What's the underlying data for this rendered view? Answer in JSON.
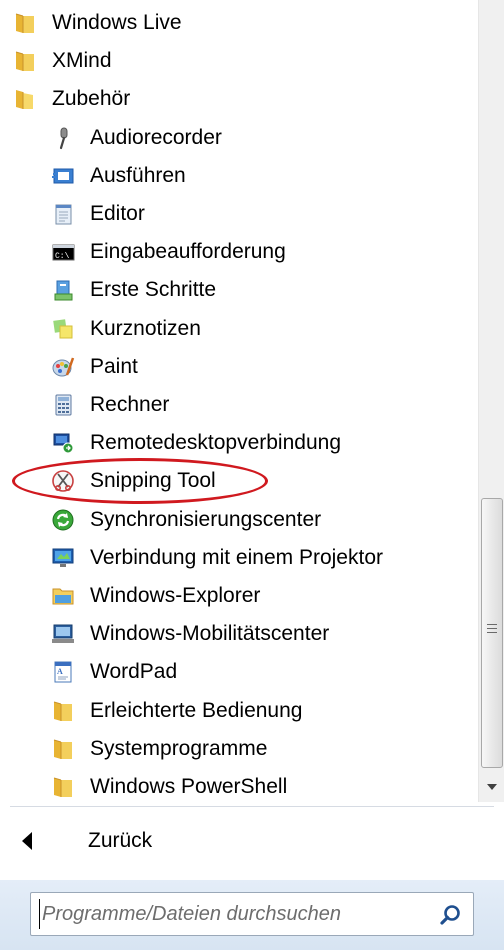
{
  "programs": {
    "items": [
      {
        "label": "Windows Live",
        "icon": "folder-icon",
        "level": 0
      },
      {
        "label": "XMind",
        "icon": "folder-icon",
        "level": 0
      },
      {
        "label": "Zubehör",
        "icon": "folder-open-icon",
        "level": 0
      },
      {
        "label": "Audiorecorder",
        "icon": "microphone-icon",
        "level": 1
      },
      {
        "label": "Ausführen",
        "icon": "run-icon",
        "level": 1
      },
      {
        "label": "Editor",
        "icon": "notepad-icon",
        "level": 1
      },
      {
        "label": "Eingabeaufforderung",
        "icon": "command-prompt-icon",
        "level": 1
      },
      {
        "label": "Erste Schritte",
        "icon": "getting-started-icon",
        "level": 1
      },
      {
        "label": "Kurznotizen",
        "icon": "sticky-notes-icon",
        "level": 1
      },
      {
        "label": "Paint",
        "icon": "paint-palette-icon",
        "level": 1
      },
      {
        "label": "Rechner",
        "icon": "calculator-icon",
        "level": 1
      },
      {
        "label": "Remotedesktopverbindung",
        "icon": "remote-desktop-icon",
        "level": 1
      },
      {
        "label": "Snipping Tool",
        "icon": "scissors-icon",
        "level": 1
      },
      {
        "label": "Synchronisierungscenter",
        "icon": "sync-icon",
        "level": 1
      },
      {
        "label": "Verbindung mit einem Projektor",
        "icon": "projector-monitor-icon",
        "level": 1
      },
      {
        "label": "Windows-Explorer",
        "icon": "explorer-folder-icon",
        "level": 1
      },
      {
        "label": "Windows-Mobilitätscenter",
        "icon": "mobility-center-icon",
        "level": 1
      },
      {
        "label": "WordPad",
        "icon": "wordpad-icon",
        "level": 1
      },
      {
        "label": "Erleichterte Bedienung",
        "icon": "folder-icon",
        "level": 1
      },
      {
        "label": "Systemprogramme",
        "icon": "folder-icon",
        "level": 1
      },
      {
        "label": "Windows PowerShell",
        "icon": "folder-icon",
        "level": 1
      }
    ],
    "highlighted": "Snipping Tool"
  },
  "back": {
    "label": "Zurück",
    "icon": "back-arrow-icon"
  },
  "search": {
    "placeholder": "Programme/Dateien durchsuchen",
    "icon": "search-icon"
  },
  "colors": {
    "highlight": "#d0191f",
    "search_bar_bg": "#dfe9f5"
  }
}
